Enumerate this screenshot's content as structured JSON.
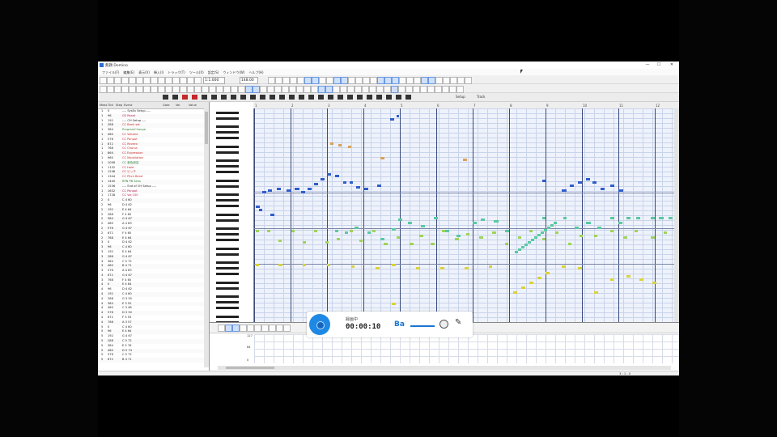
{
  "window": {
    "title": "無題 Domino",
    "minimize": "—",
    "maximize": "☐",
    "close": "✕"
  },
  "menu": [
    "ファイル(F)",
    "編集(E)",
    "表示(V)",
    "挿入(I)",
    "トラック(T)",
    "ツール(X)",
    "設定(S)",
    "ウィンドウ(W)",
    "ヘルプ(H)"
  ],
  "toolbar": {
    "position_field": "1:1:000",
    "tempo_field": "148.00",
    "tab_label": "Setup",
    "snap_label": "Track"
  },
  "event_list": {
    "headers": [
      "Meas",
      "Tick",
      "Step",
      "Event",
      "Gate",
      "Vel",
      "Value"
    ],
    "rows": [
      {
        "meas": "1",
        "tick": "0",
        "text": "---- SysEx Setup ----",
        "color": "#222"
      },
      {
        "meas": "1",
        "tick": "96",
        "text": "GS Reset",
        "color": "#c2185b"
      },
      {
        "meas": "1",
        "tick": "192",
        "text": "---- CH Setup ----",
        "color": "#222"
      },
      {
        "meas": "1",
        "tick": "288",
        "text": "CC Bank set",
        "color": "#c62828"
      },
      {
        "meas": "1",
        "tick": "384",
        "text": "ProgramChange",
        "color": "#2e7d32"
      },
      {
        "meas": "1",
        "tick": "480",
        "text": "CC Volume",
        "color": "#c62828"
      },
      {
        "meas": "1",
        "tick": "576",
        "text": "CC Panpot",
        "color": "#c62828"
      },
      {
        "meas": "1",
        "tick": "672",
        "text": "CC Reverb",
        "color": "#c62828"
      },
      {
        "meas": "1",
        "tick": "768",
        "text": "CC Chorus",
        "color": "#c62828"
      },
      {
        "meas": "1",
        "tick": "864",
        "text": "CC Expression",
        "color": "#c62828"
      },
      {
        "meas": "1",
        "tick": "960",
        "text": "CC Modulation",
        "color": "#c62828"
      },
      {
        "meas": "1",
        "tick": "1056",
        "text": "CC 音色設定",
        "color": "#2e7d32"
      },
      {
        "meas": "1",
        "tick": "1152",
        "text": "CC Hold",
        "color": "#c62828"
      },
      {
        "meas": "1",
        "tick": "1248",
        "text": "CC ピッチ",
        "color": "#c62828"
      },
      {
        "meas": "1",
        "tick": "1344",
        "text": "CC Pitch Bend",
        "color": "#c62828"
      },
      {
        "meas": "1",
        "tick": "1440",
        "text": "RPN PB Sens",
        "color": "#2e7d32"
      },
      {
        "meas": "1",
        "tick": "1536",
        "text": "---- End of CH Setup ----",
        "color": "#222"
      },
      {
        "meas": "1",
        "tick": "1632",
        "text": "CC Panpot",
        "color": "#c2185b"
      },
      {
        "meas": "1",
        "tick": "1728",
        "text": "CC Vol 100",
        "color": "#c2185b"
      },
      {
        "meas": "2",
        "tick": "0",
        "text": "C 4    60",
        "color": "#222"
      },
      {
        "meas": "2",
        "tick": "96",
        "text": "D 4    62",
        "color": "#222"
      },
      {
        "meas": "2",
        "tick": "192",
        "text": "E 4    64",
        "color": "#222"
      },
      {
        "meas": "2",
        "tick": "288",
        "text": "F 4    65",
        "color": "#222"
      },
      {
        "meas": "2",
        "tick": "384",
        "text": "G 4    67",
        "color": "#222"
      },
      {
        "meas": "2",
        "tick": "480",
        "text": "A 4    69",
        "color": "#222"
      },
      {
        "meas": "2",
        "tick": "576",
        "text": "G 4    67",
        "color": "#222"
      },
      {
        "meas": "2",
        "tick": "672",
        "text": "F 4    65",
        "color": "#222"
      },
      {
        "meas": "2",
        "tick": "768",
        "text": "E 4    64",
        "color": "#222"
      },
      {
        "meas": "3",
        "tick": "0",
        "text": "D 4    62",
        "color": "#222"
      },
      {
        "meas": "3",
        "tick": "96",
        "text": "C 4    60",
        "color": "#222"
      },
      {
        "meas": "3",
        "tick": "192",
        "text": "E 4    64",
        "color": "#222"
      },
      {
        "meas": "3",
        "tick": "288",
        "text": "G 4    67",
        "color": "#222"
      },
      {
        "meas": "3",
        "tick": "384",
        "text": "C 5    72",
        "color": "#222"
      },
      {
        "meas": "3",
        "tick": "480",
        "text": "B 4    71",
        "color": "#222"
      },
      {
        "meas": "3",
        "tick": "576",
        "text": "A 4    69",
        "color": "#222"
      },
      {
        "meas": "3",
        "tick": "672",
        "text": "G 4    67",
        "color": "#222"
      },
      {
        "meas": "3",
        "tick": "768",
        "text": "F 4    65",
        "color": "#222"
      },
      {
        "meas": "4",
        "tick": "0",
        "text": "E 4    64",
        "color": "#222"
      },
      {
        "meas": "4",
        "tick": "96",
        "text": "D 4    62",
        "color": "#222"
      },
      {
        "meas": "4",
        "tick": "192",
        "text": "C 4    60",
        "color": "#222"
      },
      {
        "meas": "4",
        "tick": "288",
        "text": "G 3    55",
        "color": "#222"
      },
      {
        "meas": "4",
        "tick": "384",
        "text": "E 3    52",
        "color": "#222"
      },
      {
        "meas": "4",
        "tick": "480",
        "text": "C 3    48",
        "color": "#222"
      },
      {
        "meas": "4",
        "tick": "576",
        "text": "D 3    50",
        "color": "#222"
      },
      {
        "meas": "4",
        "tick": "672",
        "text": "F 3    53",
        "color": "#222"
      },
      {
        "meas": "4",
        "tick": "768",
        "text": "A 3    57",
        "color": "#222"
      },
      {
        "meas": "5",
        "tick": "0",
        "text": "C 4    60",
        "color": "#222"
      },
      {
        "meas": "5",
        "tick": "96",
        "text": "E 4    64",
        "color": "#222"
      },
      {
        "meas": "5",
        "tick": "192",
        "text": "G 4    67",
        "color": "#222"
      },
      {
        "meas": "5",
        "tick": "288",
        "text": "C 5    72",
        "color": "#222"
      },
      {
        "meas": "5",
        "tick": "384",
        "text": "E 5    76",
        "color": "#222"
      },
      {
        "meas": "5",
        "tick": "480",
        "text": "D 5    74",
        "color": "#222"
      },
      {
        "meas": "5",
        "tick": "576",
        "text": "C 5    72",
        "color": "#222"
      },
      {
        "meas": "5",
        "tick": "672",
        "text": "B 4    71",
        "color": "#222"
      }
    ]
  },
  "measures": [
    "1",
    "2",
    "3",
    "4",
    "5",
    "6",
    "7",
    "8",
    "9",
    "10",
    "11",
    "12"
  ],
  "velocity_labels": [
    "127",
    "64",
    "0"
  ],
  "recorder": {
    "status": "録画中",
    "time": "00:00:10",
    "mode_icon": "Ba"
  },
  "statusbar_text": "3 : 1 : 0"
}
